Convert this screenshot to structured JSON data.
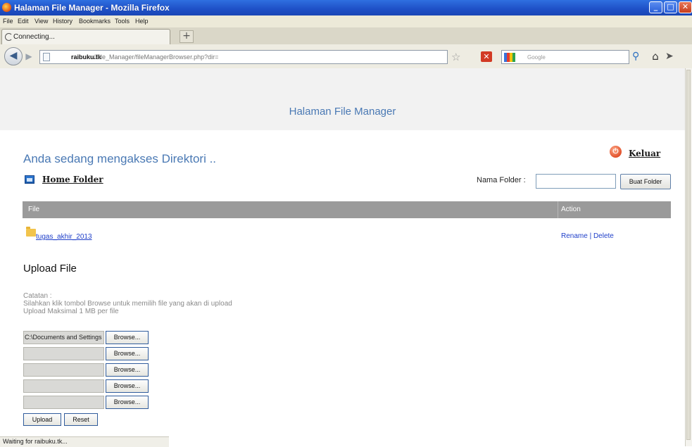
{
  "window": {
    "title": "Halaman File Manager - Mozilla Firefox",
    "controls": {
      "minimize": "_",
      "maximize": "□",
      "close": "✕"
    }
  },
  "menu": [
    "File",
    "Edit",
    "View",
    "History",
    "Bookmarks",
    "Tools",
    "Help"
  ],
  "tab": {
    "label": "Connecting...",
    "new_tab": "+"
  },
  "nav": {
    "url_host": "raibuku.tk",
    "url_path": "/File_Manager/fileManagerBrowser.php?dir=",
    "search_placeholder": "Google",
    "icons": {
      "back": "back-arrow-icon",
      "forward": "forward-arrow-icon",
      "star": "star-icon",
      "stop": "stop-icon",
      "search": "magnifier-icon",
      "home": "home-icon"
    }
  },
  "page": {
    "header": "Halaman File Manager",
    "dir_heading": "Anda sedang mengakses Direktori ..",
    "logout": "Keluar",
    "home_folder": "Home Folder",
    "folder_form": {
      "label": "Nama Folder :",
      "value": "",
      "button": "Buat Folder"
    },
    "table": {
      "headers": [
        "File",
        "Action"
      ],
      "rows": [
        {
          "name": "tugas_akhir_2013",
          "action": "Rename | Delete"
        }
      ]
    },
    "upload": {
      "title": "Upload File",
      "notes": [
        "Catatan :",
        "Silahkan klik tombol Browse untuk memilih file yang akan di upload",
        "Upload Maksimal 1 MB per file"
      ],
      "files": [
        {
          "value": "C:\\Documents and Settings",
          "button": "Browse..."
        },
        {
          "value": "",
          "button": "Browse..."
        },
        {
          "value": "",
          "button": "Browse..."
        },
        {
          "value": "",
          "button": "Browse..."
        },
        {
          "value": "",
          "button": "Browse..."
        }
      ],
      "upload_button": "Upload",
      "reset_button": "Reset"
    }
  },
  "status": "Waiting for raibuku.tk...",
  "colors": {
    "header_text": "#4a79b4",
    "table_head": "#9a9a9a",
    "link": "#1f3fc9",
    "titlebar": "#1e4fc6"
  }
}
